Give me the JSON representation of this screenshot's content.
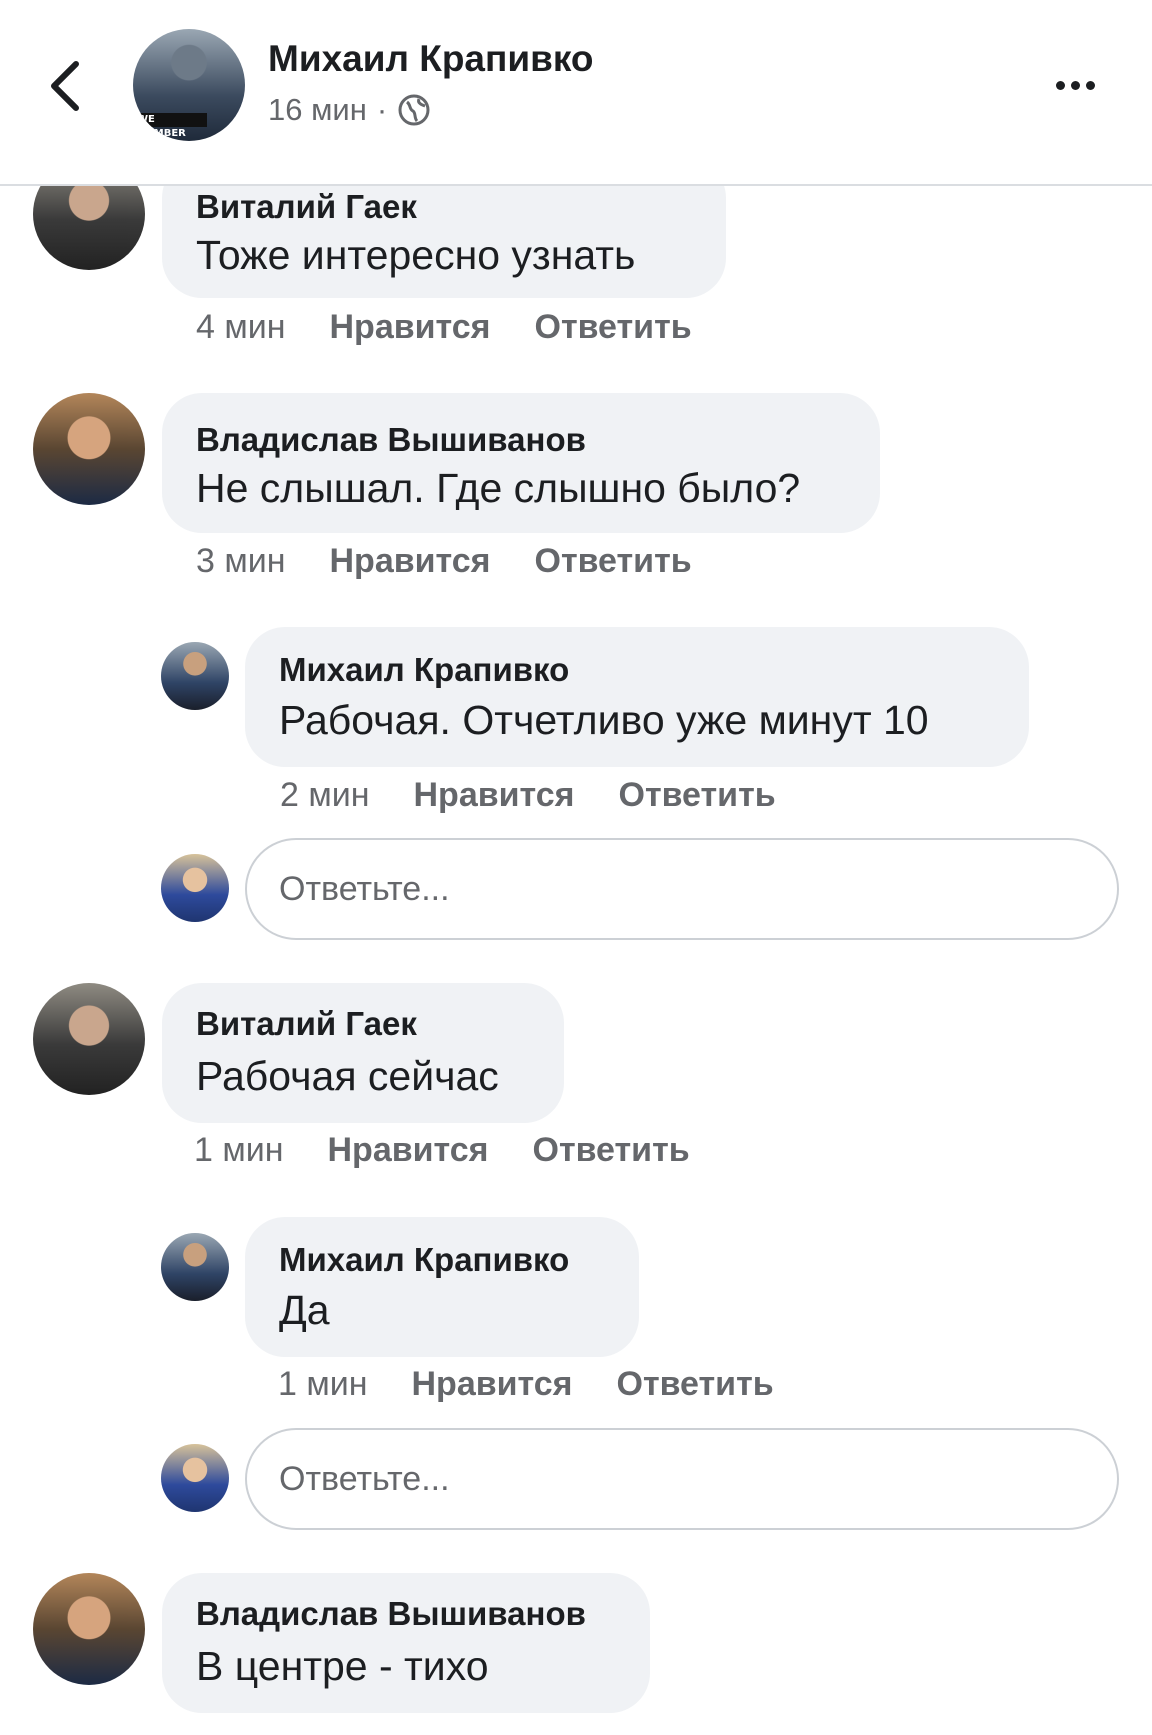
{
  "header": {
    "title": "Михаил Крапивко",
    "time": "16 мин",
    "separator": "·",
    "avatar_badge": "WE MEMBER"
  },
  "comments": [
    {
      "author": "Виталий Гаек",
      "text": "Тоже интересно узнать",
      "time": "4 мин",
      "like": "Нравится",
      "reply": "Ответить"
    },
    {
      "author": "Владислав Вышиванов",
      "text": "Не слышал. Где слышно было?",
      "time": "3 мин",
      "like": "Нравится",
      "reply": "Ответить"
    },
    {
      "author": "Михаил Крапивко",
      "text": "Рабочая. Отчетливо уже минут 10",
      "time": "2 мин",
      "like": "Нравится",
      "reply": "Ответить"
    },
    {
      "author": "Виталий Гаек",
      "text": "Рабочая сейчас",
      "time": "1 мин",
      "like": "Нравится",
      "reply": "Ответить"
    },
    {
      "author": "Михаил Крапивко",
      "text": "Да",
      "time": "1 мин",
      "like": "Нравится",
      "reply": "Ответить"
    },
    {
      "author": "Владислав Вышиванов",
      "text": "В центре - тихо"
    }
  ],
  "reply_input": {
    "placeholder": "Ответьте..."
  },
  "colors": {
    "bubble": "#f0f2f5",
    "meta": "#65676b",
    "text": "#1c1e21"
  }
}
